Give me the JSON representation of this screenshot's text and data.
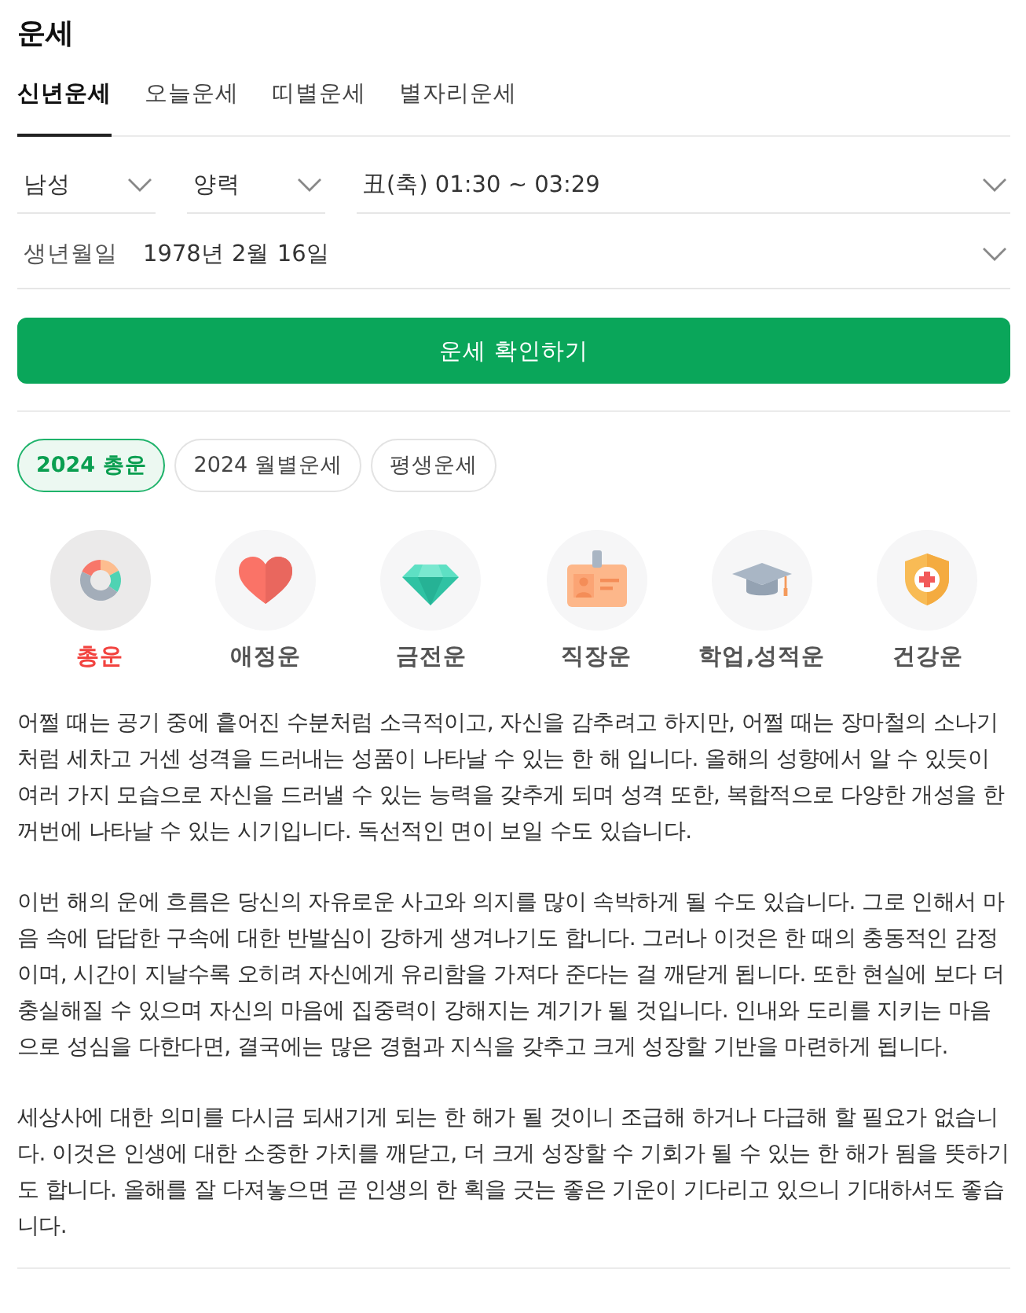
{
  "header": {
    "title": "운세"
  },
  "tabs": [
    {
      "label": "신년운세",
      "selected": true
    },
    {
      "label": "오늘운세",
      "selected": false
    },
    {
      "label": "띠별운세",
      "selected": false
    },
    {
      "label": "별자리운세",
      "selected": false
    }
  ],
  "form": {
    "selects": [
      {
        "value": "남성"
      },
      {
        "value": "양력"
      },
      {
        "value": "丑(축) 01:30 ~ 03:29"
      }
    ],
    "birth_date": {
      "label": "생년월일",
      "value": "1978년 2월 16일"
    },
    "submit_button": "운세 확인하기"
  },
  "period_chips": [
    {
      "label": "2024 총운",
      "selected": true
    },
    {
      "label": "2024 월별운세",
      "selected": false
    },
    {
      "label": "평생운세",
      "selected": false
    }
  ],
  "categories": [
    {
      "kind": "donut",
      "label": "총운",
      "selected": true
    },
    {
      "kind": "heart",
      "label": "애정운",
      "selected": false
    },
    {
      "kind": "gem",
      "label": "금전운",
      "selected": false
    },
    {
      "kind": "id_card",
      "label": "직장운",
      "selected": false
    },
    {
      "kind": "cap",
      "label": "학업,성적운",
      "selected": false
    },
    {
      "kind": "shield",
      "label": "건강운",
      "selected": false
    }
  ],
  "paragraphs": [
    "어쩔 때는 공기 중에 흩어진 수분처럼 소극적이고, 자신을 감추려고 하지만, 어쩔 때는 장마철의 소나기처럼 세차고 거센 성격을 드러내는 성품이 나타날 수 있는 한 해 입니다. 올해의 성향에서 알 수 있듯이 여러 가지 모습으로 자신을 드러낼 수 있는 능력을 갖추게 되며 성격 또한, 복합적으로 다양한 개성을 한꺼번에 나타날 수 있는 시기입니다. 독선적인 면이 보일 수도 있습니다.",
    "이번 해의 운에 흐름은 당신의 자유로운 사고와 의지를 많이 속박하게 될 수도 있습니다. 그로 인해서 마음 속에 답답한 구속에 대한 반발심이 강하게 생겨나기도 합니다. 그러나 이것은 한 때의 충동적인 감정이며, 시간이 지날수록 오히려 자신에게 유리함을 가져다 준다는 걸 깨닫게 됩니다. 또한 현실에 보다 더 충실해질 수 있으며 자신의 마음에 집중력이 강해지는 계기가 될 것입니다. 인내와 도리를 지키는 마음으로 성심을 다한다면, 결국에는 많은 경험과 지식을 갖추고 크게 성장할 기반을 마련하게 됩니다.",
    "세상사에 대한 의미를 다시금 되새기게 되는 한 해가 될 것이니 조급해 하거나 다급해 할 필요가 없습니다. 이것은 인생에 대한 소중한 가치를 깨닫고, 더 크게 성장할 수 기회가 될 수 있는 한 해가 됨을 뜻하기도 합니다. 올해를 잘 다져놓으면 곧 인생의 한 획을 긋는 좋은 기운이 기다리고 있으니 기대하셔도 좋습니다."
  ]
}
